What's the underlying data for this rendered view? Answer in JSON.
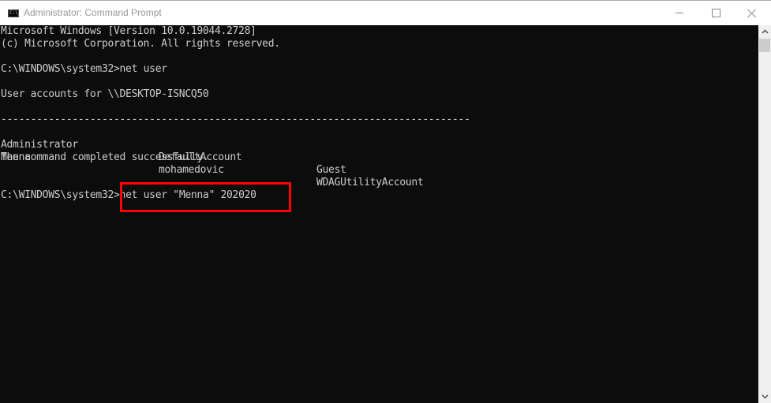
{
  "window": {
    "title": "Administrator: Command Prompt",
    "icon": "cmd-icon",
    "icon_text": "C:\\_",
    "controls": [
      "minimize",
      "maximize",
      "close"
    ]
  },
  "console": {
    "lines": {
      "l0": "Microsoft Windows [Version 10.0.19044.2728]",
      "l1": "(c) Microsoft Corporation. All rights reserved.",
      "l3": "C:\\WINDOWS\\system32>net user",
      "l5": "User accounts for \\\\DESKTOP-ISNCQ50",
      "l7": "-------------------------------------------------------------------------------",
      "l10": "The command completed successfully.",
      "l13_prompt": "C:\\WINDOWS\\system32>",
      "l13_command": "net user \"Menna\" 202020"
    },
    "accounts": {
      "row1": [
        "Administrator",
        "DefaultAccount",
        "Guest"
      ],
      "row2": [
        "Menna",
        "mohamedovic",
        "WDAGUtilityAccount"
      ]
    },
    "text_color": "#cccccc",
    "background": "#0c0c0c"
  },
  "annotation": {
    "highlight_color": "#ff0000",
    "highlighted_text": "net user \"Menna\" 202020"
  }
}
